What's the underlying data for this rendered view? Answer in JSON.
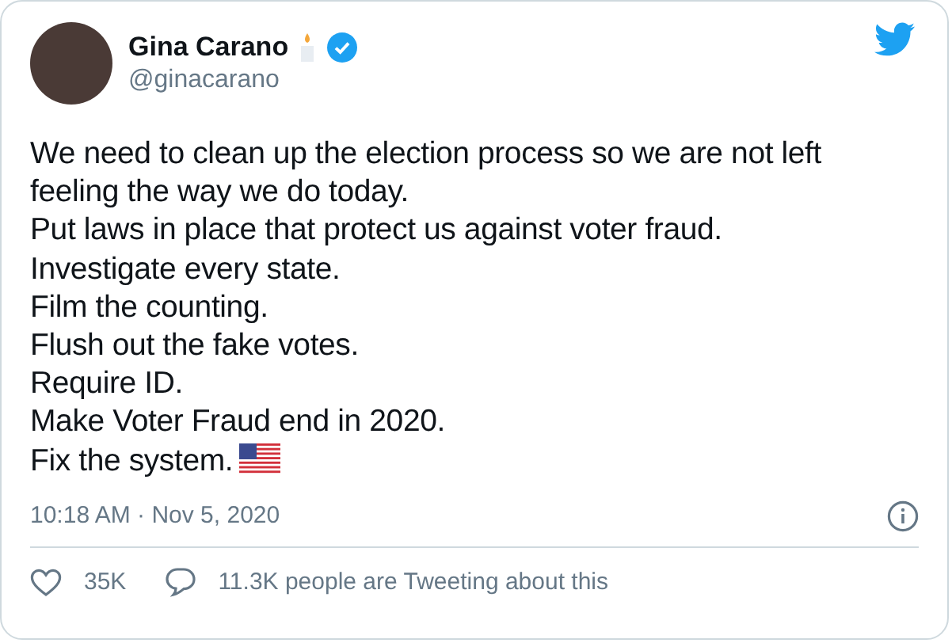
{
  "author": {
    "name": "Gina Carano",
    "handle": "@ginacarano",
    "verified": true
  },
  "lines": [
    "We need to clean up the election process so we are not left feeling the way we do today.",
    "Put laws in place that protect us against voter fraud.",
    "Investigate every state.",
    "Film the counting.",
    "Flush out the fake votes.",
    "Require ID.",
    "Make Voter Fraud end in 2020.",
    "Fix the system."
  ],
  "timestamp": "10:18 AM · Nov 5, 2020",
  "likes": "35K",
  "replies_text": "11.3K people are Tweeting about this"
}
